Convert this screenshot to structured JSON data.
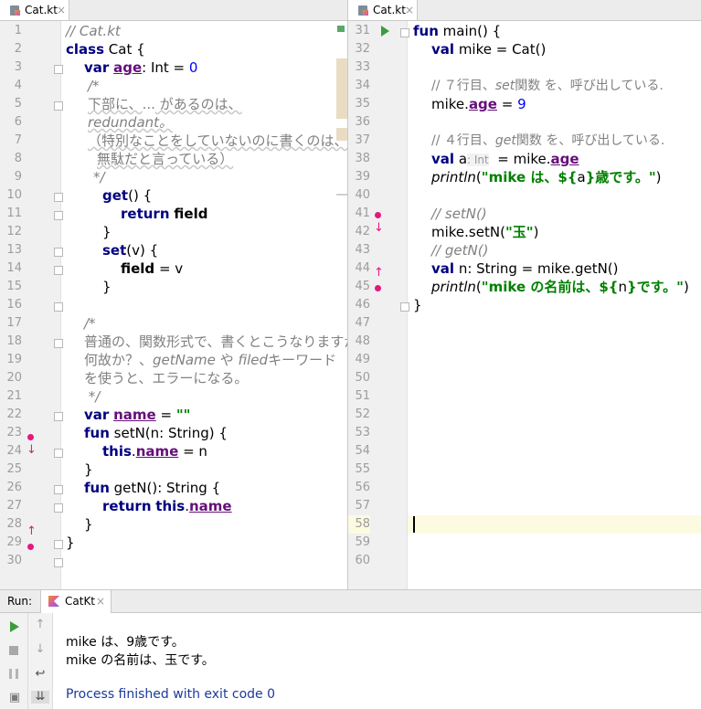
{
  "left_tab": {
    "label": "Cat.kt",
    "close": "×"
  },
  "right_tab": {
    "label": "Cat.kt",
    "close": "×"
  },
  "left_lines": [
    "1",
    "2",
    "3",
    "4",
    "5",
    "6",
    "7",
    "8",
    "9",
    "10",
    "11",
    "12",
    "13",
    "14",
    "15",
    "16",
    "17",
    "18",
    "19",
    "20",
    "21",
    "22",
    "23",
    "24",
    "25",
    "26",
    "27",
    "28",
    "29",
    "30"
  ],
  "right_lines": [
    "31",
    "32",
    "33",
    "34",
    "35",
    "36",
    "37",
    "38",
    "39",
    "40",
    "41",
    "42",
    "43",
    "44",
    "45",
    "46",
    "47",
    "48",
    "49",
    "50",
    "51",
    "52",
    "53",
    "54",
    "55",
    "56",
    "57",
    "58",
    "59",
    "60"
  ],
  "code_left": {
    "l1": "// Cat.kt",
    "l2_kw": "class",
    "l2_rest": " Cat {",
    "l3_kw": "var",
    "l3_prop": "age",
    "l3_type": ": Int = ",
    "l3_num": "0",
    "l4": "/*",
    "l5_a": "下部に、",
    "l5_b": "...",
    "l5_c": " があるのは、",
    "l6": "redundant。",
    "l7": "（特別なことをしていないのに書くのは、",
    "l8": "無駄だと言っている）",
    "l9": "*/",
    "l10_kw": "get",
    "l10_rest": "() {",
    "l11_kw": "return",
    "l11_prop": "field",
    "l12": "}",
    "l13_kw": "set",
    "l13_rest": "(v) {",
    "l14_prop": "field",
    "l14_rest": " = v",
    "l15": "}",
    "l17": "/*",
    "l18": "普通の、関数形式で、書くとこうなりますが、",
    "l19_a": "何故か？、",
    "l19_b": "getName",
    "l19_c": " や ",
    "l19_d": "filed",
    "l19_e": "キーワード",
    "l20": "を使うと、エラーになる。",
    "l21": " */",
    "l22_kw": "var",
    "l22_prop": "name",
    "l22_eq": " = ",
    "l22_str": "\"\"",
    "l23_kw": "fun",
    "l23_rest": " setN(n: String) {",
    "l24_kw": "this",
    "l24_dot": ".",
    "l24_prop": "name",
    "l24_rest": " = n",
    "l25": "}",
    "l26_kw": "fun",
    "l26_rest": " getN(): String {",
    "l27_kw": "return",
    "l27_kw2": "this",
    "l27_dot": ".",
    "l27_prop": "name",
    "l28": "}",
    "l29": "}"
  },
  "code_right": {
    "r31_kw": "fun",
    "r31_rest": " main() {",
    "r32_kw": "val",
    "r32_rest": " mike = Cat()",
    "r34_a": "// ７行目、",
    "r34_b": "set",
    "r34_c": "関数 を、呼び出している.",
    "r35_a": "mike.",
    "r35_prop": "age",
    "r35_eq": " = ",
    "r35_num": "9",
    "r37_a": "// ４行目、",
    "r37_b": "get",
    "r37_c": "関数 を、呼び出している.",
    "r38_kw": "val",
    "r38_a": " a",
    "r38_hint": ": Int",
    "r38_b": "  = mike.",
    "r38_prop": "age",
    "r39_fn": "println",
    "r39_p": "(",
    "r39_s1": "\"mike は、${",
    "r39_v": "a",
    "r39_s2": "}歳です。\"",
    "r39_e": ")",
    "r41": "// setN()",
    "r42_a": "mike.setN(",
    "r42_s": "\"玉\"",
    "r42_e": ")",
    "r43": "// getN()",
    "r44_kw": "val",
    "r44_rest": " n: String = mike.getN()",
    "r45_fn": "println",
    "r45_p": "(",
    "r45_s1": "\"mike の名前は、${",
    "r45_v": "n",
    "r45_s2": "}です。\"",
    "r45_e": ")",
    "r46": "}"
  },
  "run": {
    "label": "Run:",
    "tab": "CatKt",
    "close": "×",
    "output": [
      "mike は、9歳です。",
      "mike の名前は、玉です。"
    ],
    "exit": "Process finished with exit code 0"
  },
  "colors": {
    "keyword": "#000080",
    "property": "#660e7a",
    "string": "#008000",
    "number": "#0000ff",
    "comment": "#808080",
    "marker": "#e5177e"
  }
}
